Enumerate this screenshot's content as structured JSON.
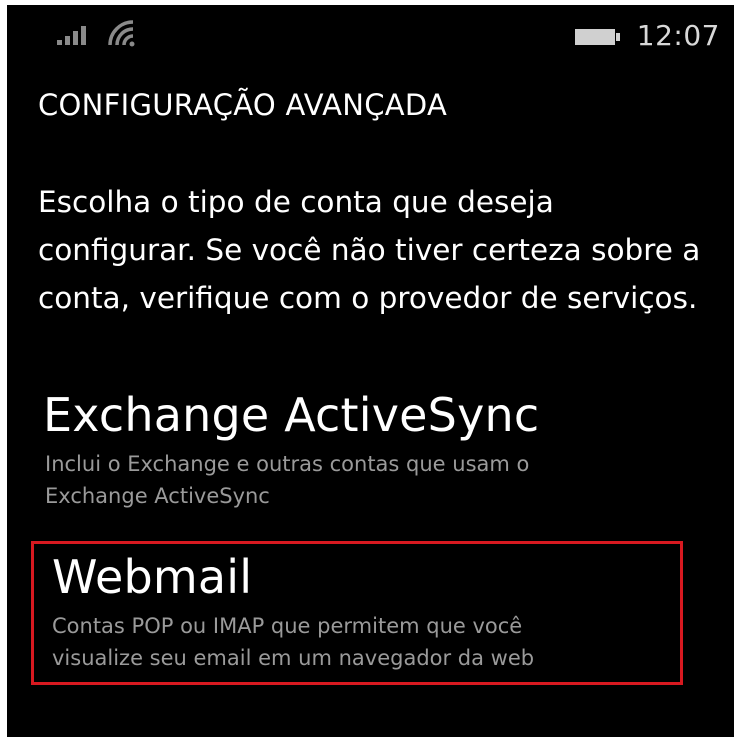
{
  "status_bar": {
    "signal_icon": "signal-strength-icon",
    "wifi_icon": "wifi-icon",
    "battery_icon": "battery-icon",
    "time": "12:07"
  },
  "page": {
    "title": "CONFIGURAÇÃO AVANÇADA",
    "description": "Escolha o tipo de conta que deseja\nconfigurar. Se você não tiver certeza sobre a\nconta, verifique com o provedor de serviços."
  },
  "options": [
    {
      "title": "Exchange ActiveSync",
      "description": "Inclui o Exchange e outras contas que usam o\nExchange ActiveSync"
    },
    {
      "title": "Webmail",
      "description": "Contas POP ou IMAP que permitem que você\nvisualize seu email em um navegador da web",
      "highlighted": true
    }
  ],
  "colors": {
    "background": "#000000",
    "text_primary": "#ffffff",
    "text_secondary": "#9a9a9a",
    "highlight_border": "#d71920"
  }
}
